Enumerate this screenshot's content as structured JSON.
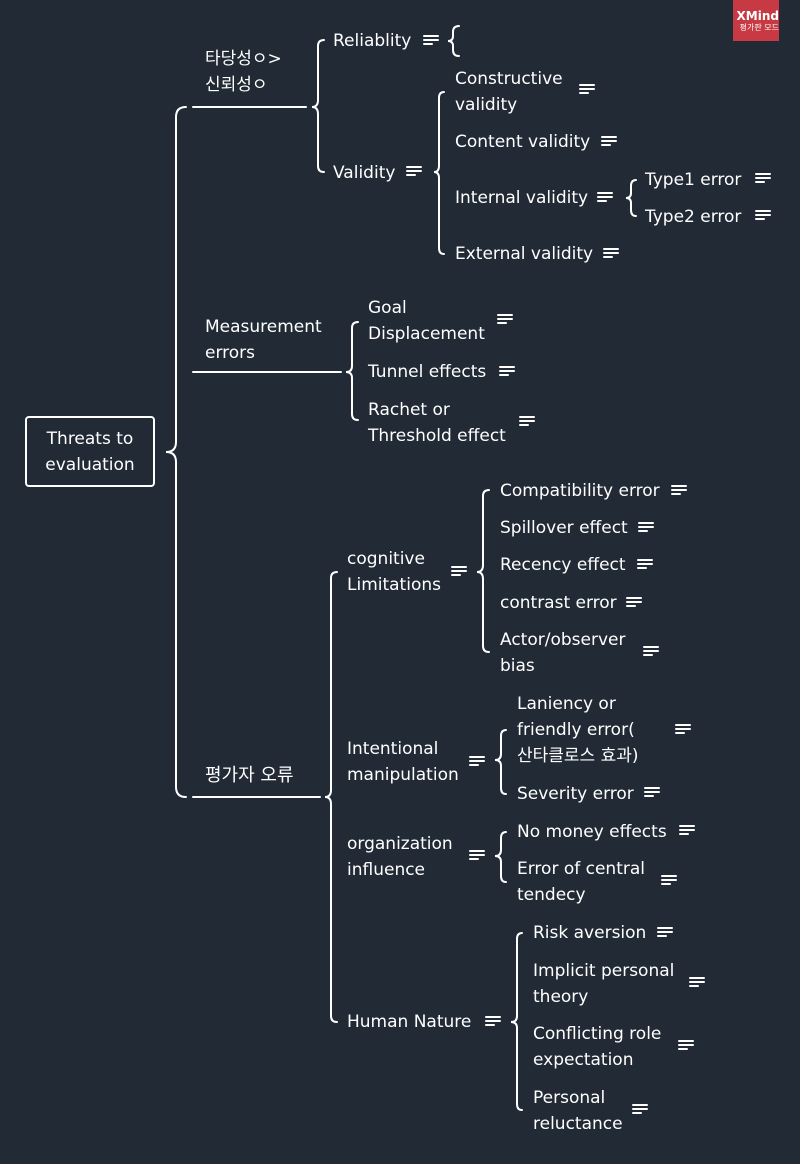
{
  "badge": {
    "brand": "XMind",
    "mode": "평가판 모드",
    "color": "#c73a44"
  },
  "colors": {
    "background": "#212a35",
    "line": "#ffffff",
    "text": "#ffffff"
  },
  "root": {
    "label": "Threats to\nevaluation",
    "line1": "Threats to",
    "line2": "evaluation"
  },
  "branches": [
    {
      "label_lines": [
        "타당성ㅇ>",
        "신뢰성ㅇ"
      ],
      "children": [
        {
          "label": "Reliablity",
          "note": true,
          "collapsed_brace": true
        },
        {
          "label": "Validity",
          "note": true,
          "children": [
            {
              "label_lines": [
                "Constructive",
                "validity"
              ],
              "note": true
            },
            {
              "label": "Content validity",
              "note": true
            },
            {
              "label": "Internal validity",
              "note": true,
              "children": [
                {
                  "label": "Type1 error",
                  "note": true
                },
                {
                  "label": "Type2 error",
                  "note": true
                }
              ]
            },
            {
              "label": "External validity",
              "note": true
            }
          ]
        }
      ]
    },
    {
      "label_lines": [
        "Measurement",
        "errors"
      ],
      "children": [
        {
          "label_lines": [
            "Goal",
            "Displacement"
          ],
          "note": true
        },
        {
          "label": "Tunnel effects",
          "note": true
        },
        {
          "label_lines": [
            "Rachet or",
            "Threshold effect"
          ],
          "note": true
        }
      ]
    },
    {
      "label": "평가자 오류",
      "children": [
        {
          "label_lines": [
            "cognitive",
            "Limitations"
          ],
          "note": true,
          "children": [
            {
              "label": "Compatibility error",
              "note": true
            },
            {
              "label": "Spillover effect",
              "note": true
            },
            {
              "label": "Recency effect",
              "note": true
            },
            {
              "label": "contrast error",
              "note": true
            },
            {
              "label_lines": [
                "Actor/observer",
                "bias"
              ],
              "note": true
            }
          ]
        },
        {
          "label_lines": [
            "Intentional",
            "manipulation"
          ],
          "note": true,
          "children": [
            {
              "label_lines": [
                "Laniency or",
                "friendly error(",
                "산타클로스 효과)"
              ],
              "note": true
            },
            {
              "label": "Severity error",
              "note": true
            }
          ]
        },
        {
          "label_lines": [
            "organization",
            "influence"
          ],
          "note": true,
          "children": [
            {
              "label": "No money effects",
              "note": true
            },
            {
              "label_lines": [
                "Error of central",
                "tendecy"
              ],
              "note": true
            }
          ]
        },
        {
          "label": "Human Nature",
          "note": true,
          "children": [
            {
              "label": "Risk aversion",
              "note": true
            },
            {
              "label_lines": [
                "Implicit personal",
                "theory"
              ],
              "note": true
            },
            {
              "label_lines": [
                "Conflicting role",
                "expectation"
              ],
              "note": true
            },
            {
              "label_lines": [
                "Personal",
                "reluctance"
              ],
              "note": true
            }
          ]
        }
      ]
    }
  ]
}
